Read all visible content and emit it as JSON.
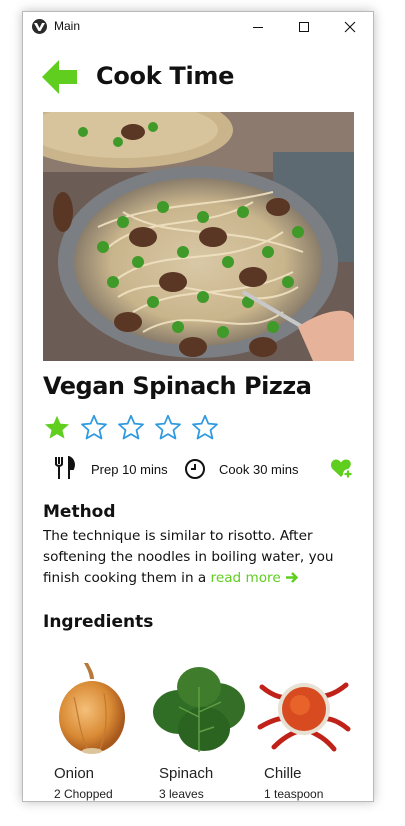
{
  "window": {
    "title": "Main"
  },
  "header": {
    "title": "Cook Time"
  },
  "recipe": {
    "name": "Vegan Spinach Pizza",
    "rating": 1,
    "max_rating": 5,
    "prep": "Prep 10 mins",
    "cook": "Cook 30 mins"
  },
  "method": {
    "title": "Method",
    "text": "The technique is similar to risotto. After softening the noodles in boiling water, you finish cooking them in a ",
    "read_more": "read more"
  },
  "ingredients": {
    "title": "Ingredients",
    "items": [
      {
        "name": "Onion",
        "qty": "2 Chopped"
      },
      {
        "name": "Spinach",
        "qty": "3 leaves"
      },
      {
        "name": "Chille",
        "qty": "1 teaspoon"
      }
    ]
  },
  "colors": {
    "accent": "#5fce1e",
    "star_outline": "#2f9ae0"
  },
  "icons": [
    "back-arrow-icon",
    "star-icon",
    "fork-knife-icon",
    "clock-icon",
    "heart-add-icon",
    "arrow-right-icon"
  ]
}
